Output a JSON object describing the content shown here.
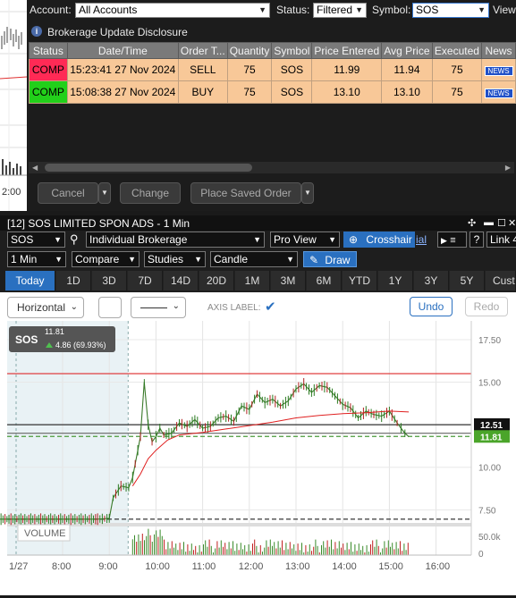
{
  "order_panel": {
    "account_label": "Account:",
    "account_value": "All Accounts",
    "status_label": "Status:",
    "status_value": "Filtered",
    "symbol_label": "Symbol:",
    "symbol_value": "SOS",
    "extra_label": "View",
    "disclosure": "Brokerage Update Disclosure",
    "columns": [
      "Status",
      "Date/Time",
      "Order T...",
      "Quantity",
      "Symbol",
      "Price Entered",
      "Avg Price",
      "Executed",
      "News"
    ],
    "rows": [
      {
        "status": "COMP",
        "datetime": "15:23:41 27 Nov 2024",
        "order_type": "SELL",
        "quantity": "75",
        "symbol": "SOS",
        "price_entered": "11.99",
        "avg_price": "11.94",
        "executed": "75",
        "news": "NEWS",
        "status_color": "#ff2a55"
      },
      {
        "status": "COMP",
        "datetime": "15:08:38 27 Nov 2024",
        "order_type": "BUY",
        "quantity": "75",
        "symbol": "SOS",
        "price_entered": "13.10",
        "avg_price": "13.10",
        "executed": "75",
        "news": "NEWS",
        "status_color": "#22d01a"
      }
    ],
    "buttons": {
      "cancel": "Cancel",
      "change": "Change",
      "place_saved": "Place Saved Order"
    },
    "left_strip_time": "2:00"
  },
  "chart_window": {
    "title": "[12] SOS LIMITED SPON ADS - 1 Min",
    "symbol": "SOS",
    "account": "Individual Brokerage",
    "view": "Pro View",
    "crosshair": "Crosshair",
    "tutorial": "ial",
    "link": "Link 4",
    "help": "?",
    "interval": "1 Min",
    "compare": "Compare",
    "studies": "Studies",
    "chart_style": "Candle",
    "draw": "Draw",
    "periods": [
      "Today",
      "1D",
      "3D",
      "7D",
      "14D",
      "20D",
      "1M",
      "3M",
      "6M",
      "YTD",
      "1Y",
      "3Y",
      "5Y",
      "Custo"
    ],
    "active_period": "Today",
    "drawing_tool": "Horizontal",
    "axis_label_text": "AXIS LABEL:",
    "undo": "Undo",
    "redo": "Redo",
    "accent": "#2a70c0"
  },
  "chart_data": {
    "type": "line",
    "symbol_badge": "SOS",
    "last_price": "11.81",
    "change_text": "4.86 (69.93%)",
    "y_ticks": [
      "17.50",
      "15.00",
      "12.50",
      "10.00",
      "7.50"
    ],
    "y_range": [
      6.1,
      18.6
    ],
    "x_ticks": [
      "1/27",
      "8:00",
      "9:00",
      "10:00",
      "11:00",
      "12:00",
      "13:00",
      "14:00",
      "15:00",
      "16:00"
    ],
    "volume_label": "VOLUME",
    "volume_ticks": [
      "50.0k",
      "0"
    ],
    "horizontal_lines": [
      {
        "value": 15.5,
        "color": "#e04040",
        "style": "solid"
      },
      {
        "value": 12.5,
        "color": "#333333",
        "style": "solid"
      },
      {
        "value": 12.0,
        "color": "#666666",
        "style": "solid"
      },
      {
        "value": 11.81,
        "color": "#4a9a3a",
        "style": "dashed"
      },
      {
        "value": 6.95,
        "color": "#222222",
        "style": "dashed"
      }
    ],
    "price_tags": [
      {
        "text": "12.51",
        "value": 12.51,
        "color": "#111111"
      },
      {
        "text": "11.81",
        "value": 11.81,
        "color": "#4aa52a"
      }
    ],
    "price_series": [
      [
        "4:00",
        6.95
      ],
      [
        "8:00",
        6.95
      ],
      [
        "8:45",
        6.95
      ],
      [
        "9:00",
        7.0
      ],
      [
        "9:05",
        8.2
      ],
      [
        "9:15",
        8.9
      ],
      [
        "9:25",
        8.8
      ],
      [
        "9:30",
        9.4
      ],
      [
        "9:40",
        11.8
      ],
      [
        "9:45",
        15.0
      ],
      [
        "9:50",
        12.5
      ],
      [
        "9:55",
        11.5
      ],
      [
        "10:00",
        11.8
      ],
      [
        "10:05",
        12.3
      ],
      [
        "10:10",
        11.9
      ],
      [
        "10:20",
        12.0
      ],
      [
        "10:30",
        12.6
      ],
      [
        "10:40",
        12.4
      ],
      [
        "10:50",
        12.8
      ],
      [
        "11:00",
        12.3
      ],
      [
        "11:10",
        12.4
      ],
      [
        "11:20",
        12.9
      ],
      [
        "11:30",
        13.0
      ],
      [
        "11:40",
        12.7
      ],
      [
        "11:50",
        13.6
      ],
      [
        "12:00",
        13.4
      ],
      [
        "12:10",
        14.3
      ],
      [
        "12:20",
        13.8
      ],
      [
        "12:30",
        14.0
      ],
      [
        "12:40",
        13.6
      ],
      [
        "12:50",
        13.9
      ],
      [
        "13:00",
        14.6
      ],
      [
        "13:10",
        14.9
      ],
      [
        "13:20",
        14.4
      ],
      [
        "13:30",
        14.8
      ],
      [
        "13:40",
        14.7
      ],
      [
        "13:50",
        14.2
      ],
      [
        "14:00",
        13.7
      ],
      [
        "14:10",
        13.5
      ],
      [
        "14:20",
        12.9
      ],
      [
        "14:30",
        13.3
      ],
      [
        "14:40",
        13.1
      ],
      [
        "14:50",
        13.0
      ],
      [
        "15:00",
        13.3
      ],
      [
        "15:10",
        12.6
      ],
      [
        "15:15",
        12.3
      ],
      [
        "15:20",
        12.0
      ],
      [
        "15:25",
        11.8
      ]
    ],
    "vwap_series": [
      [
        "9:30",
        8.9
      ],
      [
        "9:40",
        9.6
      ],
      [
        "9:50",
        10.5
      ],
      [
        "10:00",
        11.0
      ],
      [
        "10:15",
        11.6
      ],
      [
        "10:30",
        11.9
      ],
      [
        "11:00",
        12.05
      ],
      [
        "11:30",
        12.25
      ],
      [
        "12:00",
        12.45
      ],
      [
        "12:30",
        12.65
      ],
      [
        "13:00",
        12.9
      ],
      [
        "13:30",
        13.05
      ],
      [
        "14:00",
        13.15
      ],
      [
        "14:30",
        13.2
      ],
      [
        "15:00",
        13.3
      ],
      [
        "15:25",
        13.25
      ]
    ],
    "grid": true
  }
}
